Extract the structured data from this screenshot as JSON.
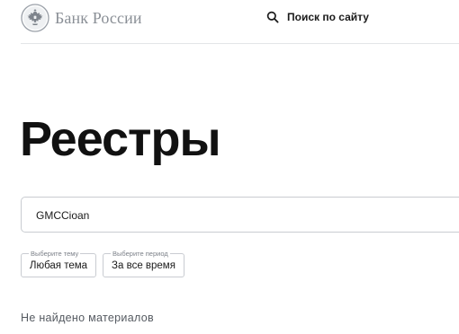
{
  "header": {
    "logo_text": "Банк России",
    "search_link_label": "Поиск по сайту"
  },
  "main": {
    "title": "Реестры",
    "search": {
      "value": "GMCCioan",
      "placeholder": ""
    },
    "filters": {
      "topic": {
        "legend": "Выберите тему",
        "value": "Любая тема"
      },
      "period": {
        "legend": "Выберите период",
        "value": "За все время"
      }
    },
    "empty_message": "Не найдено материалов"
  },
  "colors": {
    "text_primary": "#111111",
    "logo_text": "#8a8f96",
    "border": "#c9ccd1",
    "muted": "#7c8189",
    "divider": "#e3e5e8"
  },
  "icons": {
    "logo": "double-headed-eagle-emblem",
    "search": "search-icon"
  }
}
